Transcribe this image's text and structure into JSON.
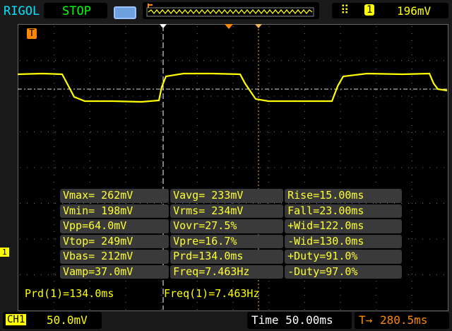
{
  "header": {
    "brand": "RIGOL",
    "run_state": "STOP",
    "trigger_level": "196mV",
    "trigger_channel": "1",
    "trigger_slope_icon": "rising-edge-icon"
  },
  "measurements": [
    [
      "Vmax= 262mV",
      "Vavg= 233mV",
      "Rise=15.00ms"
    ],
    [
      "Vmin= 198mV",
      "Vrms= 234mV",
      "Fall=23.00ms"
    ],
    [
      "Vpp=64.0mV",
      "Vovr=27.5%",
      "+Wid=122.0ms"
    ],
    [
      "Vtop= 249mV",
      "Vpre=16.7%",
      "-Wid=130.0ms"
    ],
    [
      "Vbas= 212mV",
      "Prd=134.0ms",
      "+Duty=91.0%"
    ],
    [
      "Vamp=37.0mV",
      "Freq=7.463Hz",
      "-Duty=97.0%"
    ]
  ],
  "cursor_readout": {
    "period": "Prd(1)=134.0ms",
    "frequency": "Freq(1)=7.463Hz"
  },
  "footer": {
    "channel": "CH1",
    "channel_scale": "50.0mV",
    "timebase": "Time 50.00ms",
    "trigger_offset": "280.5ms"
  },
  "markers": {
    "trigger": "T",
    "channel": "1"
  },
  "colors": {
    "trace": "#ffff00",
    "trigger": "#ff8c00",
    "brand": "#00e5ff",
    "stop": "#00ff00"
  }
}
